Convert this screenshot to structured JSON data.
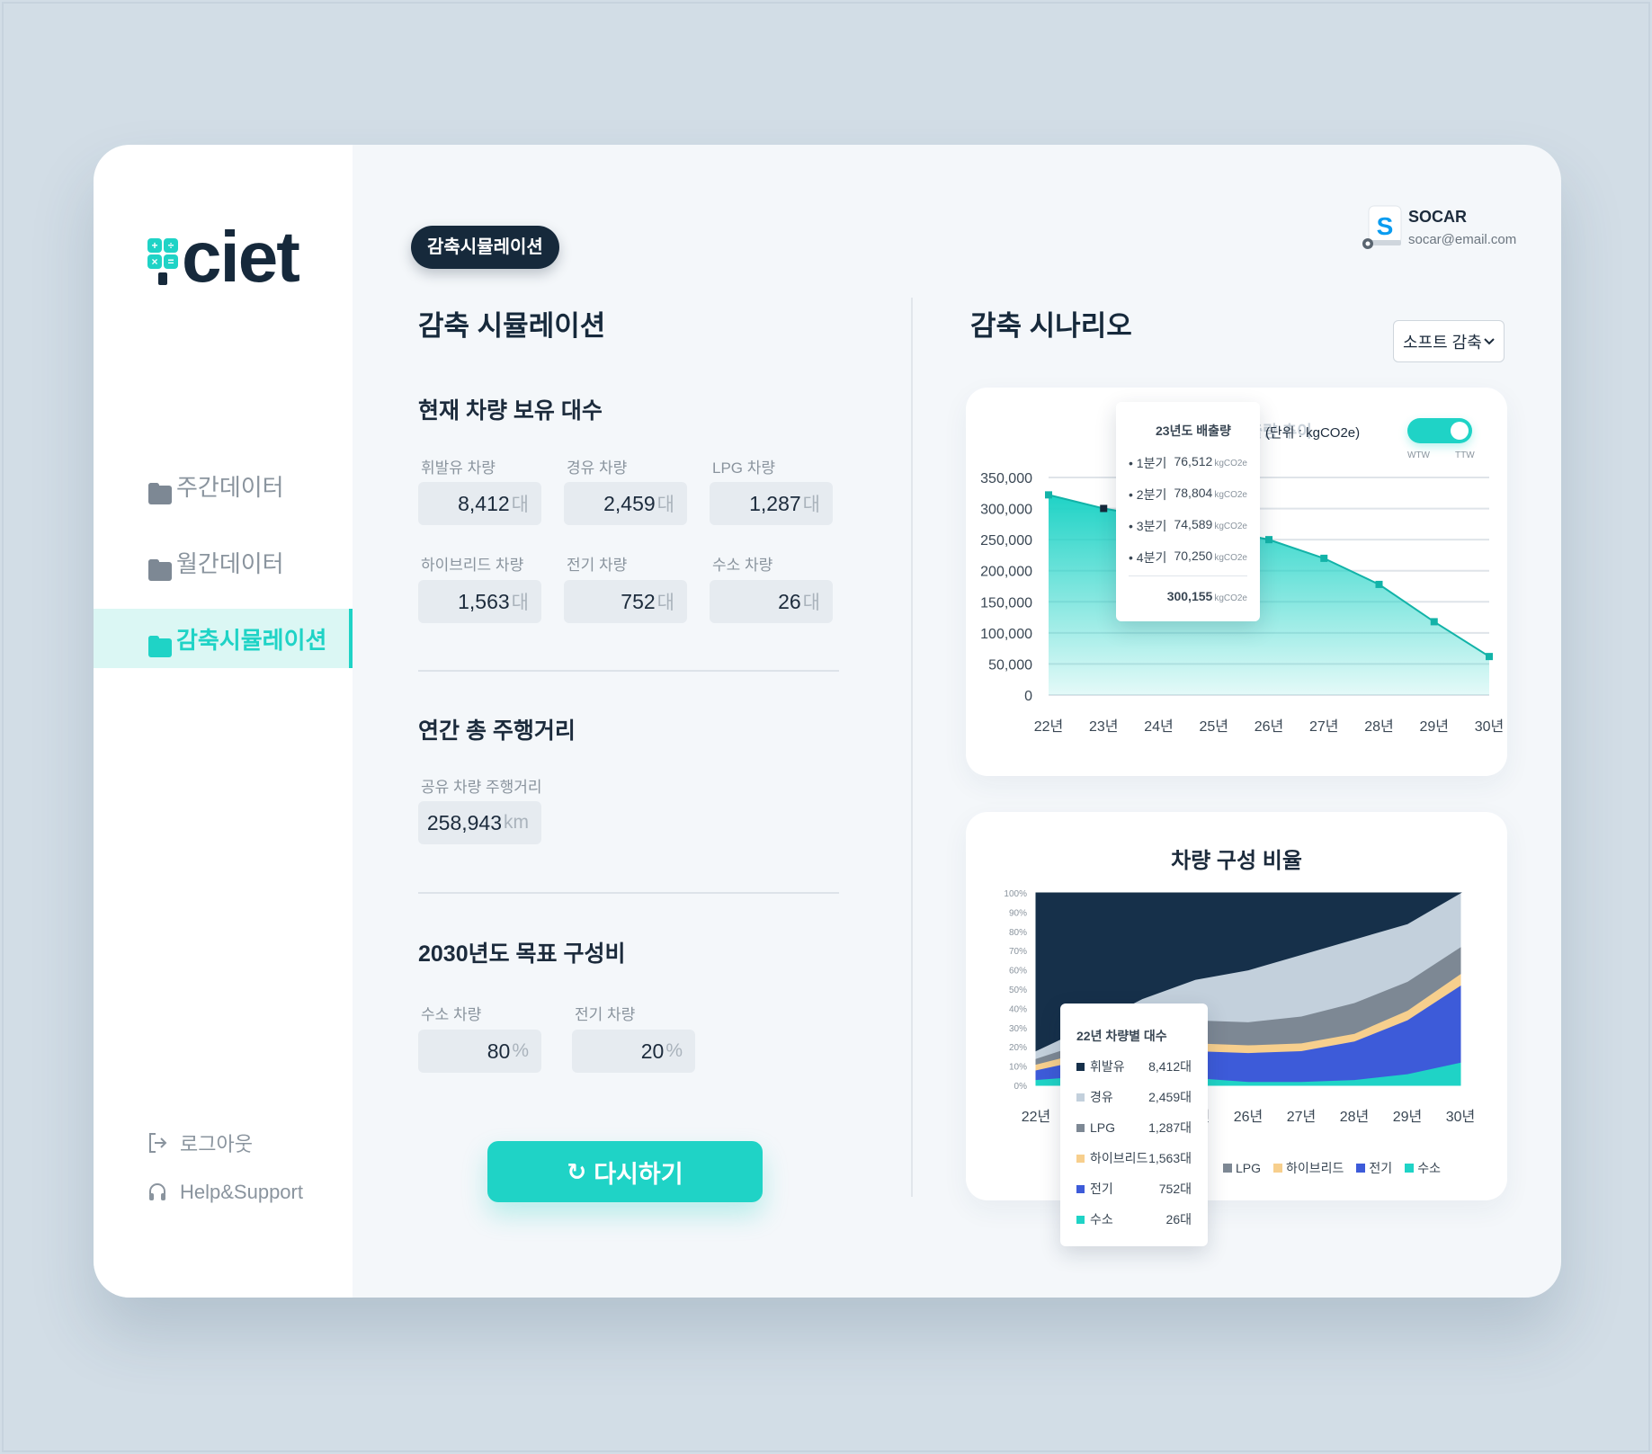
{
  "app": {
    "logo_text": "ciet",
    "logo_symbols": [
      "+",
      "÷",
      "×",
      "="
    ]
  },
  "sidebar": {
    "items": [
      {
        "label": "주간데이터",
        "active": false
      },
      {
        "label": "월간데이터",
        "active": false
      },
      {
        "label": "감축시뮬레이션",
        "active": true
      }
    ],
    "footer": {
      "logout": "로그아웃",
      "help": "Help&Support"
    }
  },
  "colors": {
    "accent": "#1fd3c6",
    "navy": "#16293b",
    "active_bg": "#dbf7f4"
  },
  "simulation": {
    "pill": "감축시뮬레이션",
    "title": "감축 시뮬레이션",
    "vehicles": {
      "title": "현재 차량 보유 대수",
      "fields": [
        {
          "label": "휘발유 차량",
          "value": "8,412",
          "unit": "대"
        },
        {
          "label": "경유 차량",
          "value": "2,459",
          "unit": "대"
        },
        {
          "label": "LPG 차량",
          "value": "1,287",
          "unit": "대"
        },
        {
          "label": "하이브리드 차량",
          "value": "1,563",
          "unit": "대"
        },
        {
          "label": "전기 차량",
          "value": "752",
          "unit": "대"
        },
        {
          "label": "수소 차량",
          "value": "26",
          "unit": "대"
        }
      ]
    },
    "mileage": {
      "title": "연간 총 주행거리",
      "label": "공유 차량 주행거리",
      "value": "258,943",
      "unit": "km"
    },
    "target": {
      "title": "2030년도 목표 구성비",
      "fields": [
        {
          "label": "수소 차량",
          "value": "80",
          "unit": "%"
        },
        {
          "label": "전기 차량",
          "value": "20",
          "unit": "%"
        }
      ]
    },
    "retry_label": "다시하기"
  },
  "scenario": {
    "title": "감축 시나리오",
    "dropdown_value": "소프트 감축",
    "user": {
      "name": "SOCAR",
      "email": "socar@email.com",
      "avatar_letter": "S"
    },
    "emission_chart": {
      "title_partial": "배출량 추이",
      "unit_label": "(단위 : kgCO2e)",
      "toggle_left": "WTW",
      "toggle_right": "TTW",
      "tooltip": {
        "title": "23년도 배출량",
        "rows": [
          {
            "label": "1분기",
            "value": "76,512",
            "unit": "kgCO2e"
          },
          {
            "label": "2분기",
            "value": "78,804",
            "unit": "kgCO2e"
          },
          {
            "label": "3분기",
            "value": "74,589",
            "unit": "kgCO2e"
          },
          {
            "label": "4분기",
            "value": "70,250",
            "unit": "kgCO2e"
          }
        ],
        "total": "300,155",
        "total_unit": "kgCO2e"
      }
    },
    "composition_chart": {
      "title": "차량 구성 비율",
      "legend": [
        "휘발유",
        "경유",
        "LPG",
        "하이브리드",
        "전기",
        "수소"
      ],
      "tooltip": {
        "title": "22년 차량별 대수",
        "rows": [
          {
            "label": "휘발유",
            "value": "8,412대"
          },
          {
            "label": "경유",
            "value": "2,459대"
          },
          {
            "label": "LPG",
            "value": "1,287대"
          },
          {
            "label": "하이브리드",
            "value": "1,563대"
          },
          {
            "label": "전기",
            "value": "752대"
          },
          {
            "label": "수소",
            "value": "26대"
          }
        ]
      }
    }
  },
  "chart_data": [
    {
      "type": "area",
      "title": "",
      "ylabel": "(단위 : kgCO2e)",
      "x": [
        "22년",
        "23년",
        "24년",
        "25년",
        "26년",
        "27년",
        "28년",
        "29년",
        "30년"
      ],
      "series": [
        {
          "name": "",
          "values": [
            322000,
            300155,
            285000,
            268000,
            250000,
            220000,
            178000,
            118000,
            62000
          ]
        }
      ],
      "ylim": [
        0,
        350000
      ],
      "yticks": [
        "0",
        "50,000",
        "100,000",
        "150,000",
        "200,000",
        "250,000",
        "300,000",
        "350,000"
      ],
      "grid": true,
      "color": "#1fd3c6"
    },
    {
      "type": "area",
      "title": "차량 구성 비율",
      "x": [
        "22년",
        "23년",
        "24년",
        "25년",
        "26년",
        "27년",
        "28년",
        "29년",
        "30년"
      ],
      "yticks": [
        "0%",
        "10%",
        "20%",
        "30%",
        "40%",
        "50%",
        "60%",
        "70%",
        "80%",
        "90%",
        "100%"
      ],
      "ylim": [
        0,
        100
      ],
      "stacked": true,
      "legend": "bottom",
      "series": [
        {
          "name": "수소",
          "color": "#1fd3c6",
          "values": [
            3,
            5,
            6,
            4,
            2,
            2,
            3,
            6,
            12
          ]
        },
        {
          "name": "전기",
          "color": "#3d5bd9",
          "values": [
            5,
            9,
            12,
            14,
            15,
            16,
            20,
            28,
            40
          ]
        },
        {
          "name": "하이브리드",
          "color": "#f7cf8d",
          "values": [
            3,
            4,
            4,
            4,
            4,
            4,
            4,
            5,
            6
          ]
        },
        {
          "name": "LPG",
          "color": "#7d8894",
          "values": [
            3,
            5,
            9,
            12,
            12,
            14,
            16,
            15,
            14
          ]
        },
        {
          "name": "경유",
          "color": "#c3d0dc",
          "values": [
            4,
            8,
            14,
            21,
            27,
            32,
            33,
            30,
            28
          ]
        },
        {
          "name": "휘발유",
          "color": "#16304a",
          "values": [
            82,
            69,
            55,
            45,
            40,
            32,
            24,
            16,
            0
          ]
        }
      ]
    }
  ]
}
